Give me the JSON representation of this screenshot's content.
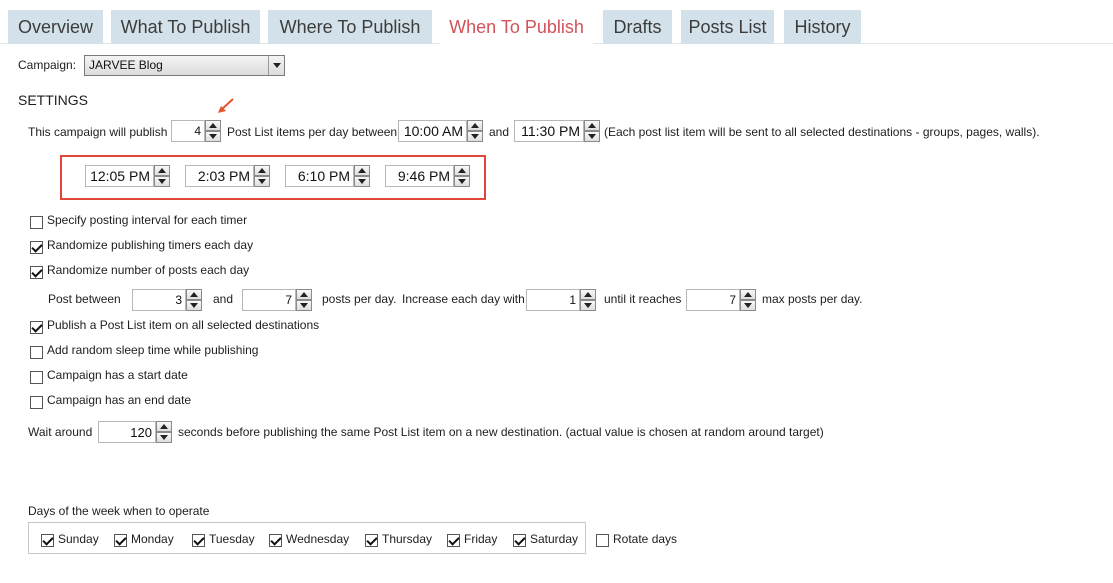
{
  "tabs": [
    {
      "label": "Overview"
    },
    {
      "label": "What To Publish"
    },
    {
      "label": "Where To Publish"
    },
    {
      "label": "When To Publish",
      "active": true
    },
    {
      "label": "Drafts"
    },
    {
      "label": "Posts List"
    },
    {
      "label": "History"
    }
  ],
  "campaign": {
    "label": "Campaign:",
    "value": "JARVEE Blog"
  },
  "settings_heading": "SETTINGS",
  "publish_row": {
    "prefix": "This campaign will publish",
    "count": "4",
    "middle": "Post List items per day between",
    "start_time": "10:00 AM",
    "and": "and",
    "end_time": "11:30 PM",
    "note": "(Each post list item will be sent to all selected destinations - groups, pages, walls)."
  },
  "timers": [
    "12:05 PM",
    "2:03 PM",
    "6:10 PM",
    "9:46 PM"
  ],
  "options": [
    {
      "label": "Specify posting interval for each timer",
      "checked": false
    },
    {
      "label": "Randomize publishing timers each day",
      "checked": true
    },
    {
      "label": "Randomize number of posts each day",
      "checked": true
    },
    {
      "label": "Publish a Post List item on all selected destinations",
      "checked": true
    },
    {
      "label": "Add random sleep time while publishing",
      "checked": false
    },
    {
      "label": "Campaign has a start date",
      "checked": false
    },
    {
      "label": "Campaign has an end date",
      "checked": false
    }
  ],
  "post_between": {
    "label": "Post between",
    "min": "3",
    "and": "and",
    "max": "7",
    "posts_per_day": "posts per day.",
    "increase_label": "Increase each day with",
    "increase": "1",
    "until_label": "until it reaches",
    "limit": "7",
    "max_label": "max posts per day."
  },
  "wait": {
    "label": "Wait around",
    "value": "120",
    "suffix": "seconds before publishing the same Post List item on a new destination. (actual value is chosen at random around target)"
  },
  "days": {
    "label": "Days of the week when to operate",
    "items": [
      {
        "label": "Sunday",
        "checked": true
      },
      {
        "label": "Monday",
        "checked": true
      },
      {
        "label": "Tuesday",
        "checked": true
      },
      {
        "label": "Wednesday",
        "checked": true
      },
      {
        "label": "Thursday",
        "checked": true
      },
      {
        "label": "Friday",
        "checked": true
      },
      {
        "label": "Saturday",
        "checked": true
      }
    ],
    "rotate": {
      "label": "Rotate days",
      "checked": false
    }
  },
  "colors": {
    "active_tab_text": "#d2525a",
    "tab_bg": "#d3e2ea",
    "highlight_border": "#e2463b",
    "annotation_arrow": "#e8532b"
  }
}
